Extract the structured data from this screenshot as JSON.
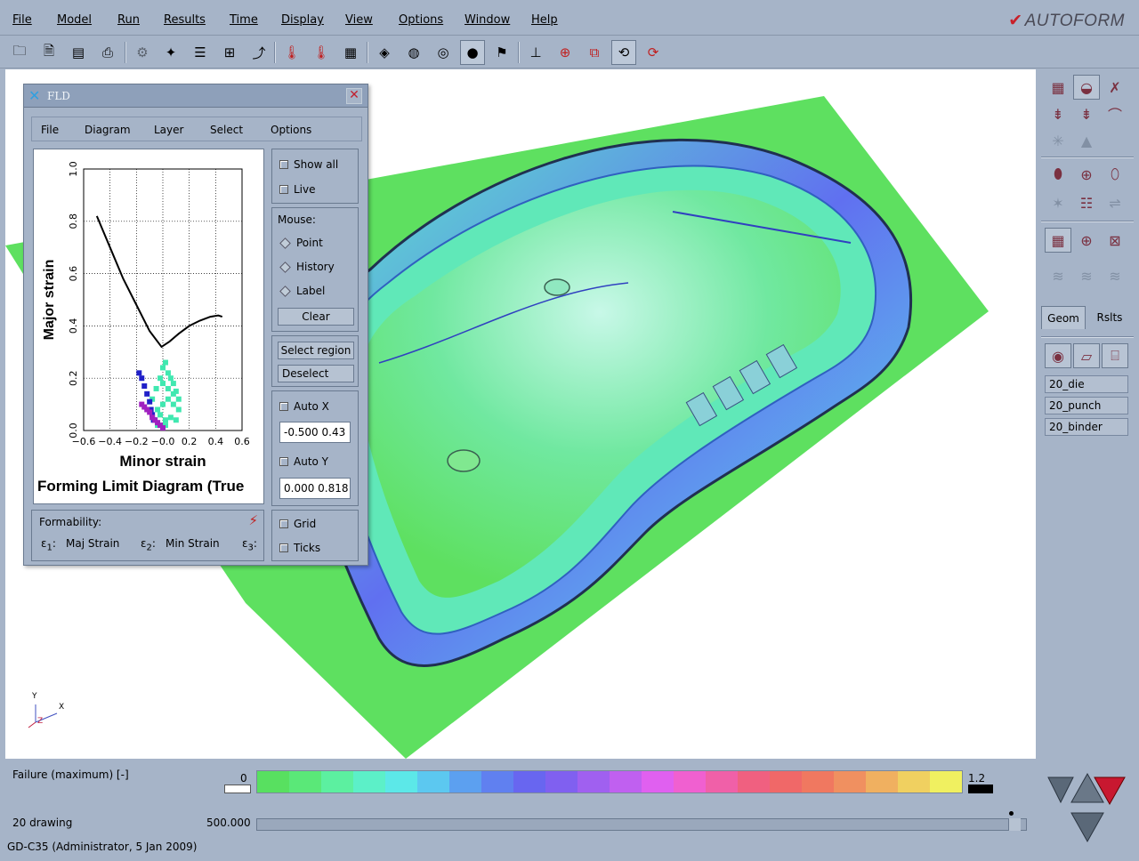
{
  "menu": {
    "items": [
      "File",
      "Model",
      "Run",
      "Results",
      "Time",
      "Display",
      "View",
      "Options",
      "Window",
      "Help"
    ],
    "brand": "AUTOFORM"
  },
  "toolbar": {
    "icons": [
      "open-file-icon",
      "save-file-icon",
      "save-as-icon",
      "print-icon",
      "tool-disabled-icon",
      "tool-red-icon",
      "tool-stack-icon",
      "tool-press-icon",
      "curve-icon",
      "thermometer-icon",
      "thermometer-2-icon",
      "stress-icon",
      "section-icon",
      "globe-mesh-icon",
      "globe-wire-icon",
      "sphere-icon",
      "flag-icon",
      "axis-icon",
      "grid-target-icon",
      "multi-window-icon",
      "rotate-icon",
      "tilt-icon"
    ]
  },
  "fld": {
    "title": "FLD",
    "menu": [
      "File",
      "Diagram",
      "Layer",
      "Select",
      "Options"
    ],
    "show_all": "Show all",
    "live": "Live",
    "mouse_label": "Mouse:",
    "point": "Point",
    "history": "History",
    "label": "Label",
    "clear": "Clear",
    "select_region": "Select region",
    "deselect": "Deselect",
    "auto_x": "Auto X",
    "x_range": "-0.500 0.43",
    "auto_y": "Auto Y",
    "y_range": "0.000 0.818",
    "grid": "Grid",
    "ticks": "Ticks",
    "formability": "Formability:",
    "e1": "Maj Strain",
    "e2": "Min Strain"
  },
  "chart_data": {
    "type": "scatter",
    "title": "Forming Limit Diagram (True",
    "xlabel": "Minor strain",
    "ylabel": "Major strain",
    "xlim": [
      -0.6,
      0.6
    ],
    "ylim": [
      0.0,
      1.0
    ],
    "xticks": [
      "−0.6",
      "−0.4",
      "−0.2",
      "−0.0",
      "0.2",
      "0.4",
      "0.6"
    ],
    "yticks": [
      "0.0",
      "0.2",
      "0.4",
      "0.6",
      "0.8",
      "1.0"
    ],
    "grid": true,
    "series": [
      {
        "kind": "line",
        "color": "#000000",
        "x": [
          -0.5,
          -0.4,
          -0.3,
          -0.2,
          -0.1,
          -0.01,
          0.05,
          0.12,
          0.2,
          0.28,
          0.36,
          0.42,
          0.45
        ],
        "y": [
          0.82,
          0.7,
          0.58,
          0.48,
          0.38,
          0.32,
          0.34,
          0.37,
          0.4,
          0.42,
          0.435,
          0.44,
          0.435
        ]
      },
      {
        "kind": "cluster",
        "color": "#40e8b0",
        "x": [
          -0.08,
          -0.05,
          -0.02,
          0.0,
          0.02,
          0.04,
          0.06,
          0.08,
          0.1,
          0.12,
          -0.04,
          0.0,
          0.04,
          0.08,
          0.12,
          -0.06,
          -0.02,
          0.02,
          0.06,
          0.1,
          0.0,
          0.04,
          0.08,
          -0.04,
          0.02
        ],
        "y": [
          0.12,
          0.16,
          0.2,
          0.24,
          0.26,
          0.22,
          0.2,
          0.18,
          0.15,
          0.12,
          0.08,
          0.1,
          0.12,
          0.1,
          0.08,
          0.04,
          0.06,
          0.04,
          0.05,
          0.04,
          0.18,
          0.16,
          0.14,
          0.02,
          0.02
        ]
      },
      {
        "kind": "cluster",
        "color": "#2020c8",
        "x": [
          -0.18,
          -0.16,
          -0.14,
          -0.12,
          -0.1,
          -0.09,
          -0.08,
          -0.07
        ],
        "y": [
          0.22,
          0.2,
          0.17,
          0.14,
          0.11,
          0.08,
          0.06,
          0.04
        ]
      },
      {
        "kind": "cluster",
        "color": "#a020c0",
        "x": [
          -0.16,
          -0.14,
          -0.12,
          -0.1,
          -0.08,
          -0.06,
          -0.04,
          -0.02,
          0.0
        ],
        "y": [
          0.1,
          0.09,
          0.08,
          0.07,
          0.05,
          0.04,
          0.03,
          0.02,
          0.01
        ]
      }
    ]
  },
  "right_panel": {
    "tab_geom": "Geom",
    "tab_rslts": "Rslts",
    "objects": [
      "20_die",
      "20_punch",
      "20_binder"
    ]
  },
  "bottom": {
    "result_label": "Failure (maximum)  [-]",
    "scale_min": "0",
    "scale_max": "1.2",
    "stage": "20 drawing",
    "stroke": "500.000",
    "status": "GD-C35 (Administrator,  5 Jan 2009)"
  },
  "viewport": {
    "axis_y": "Y",
    "axis_z": "Z",
    "axis_x": "X"
  },
  "colors": {
    "background": "#a6b4c8",
    "part_green": "#5ee060",
    "colorbar": [
      "#58e060",
      "#5ae878",
      "#5cf0a0",
      "#5cf0c8",
      "#5ce8e8",
      "#5cc8f0",
      "#5ca0f0",
      "#6080f0",
      "#6866f0",
      "#8060f0",
      "#a060f0",
      "#c060f0",
      "#e060f0",
      "#f060d0",
      "#f060a8",
      "#f06080",
      "#f06868",
      "#f07860",
      "#f09060",
      "#f0b060",
      "#f0d060",
      "#f0f060"
    ]
  }
}
